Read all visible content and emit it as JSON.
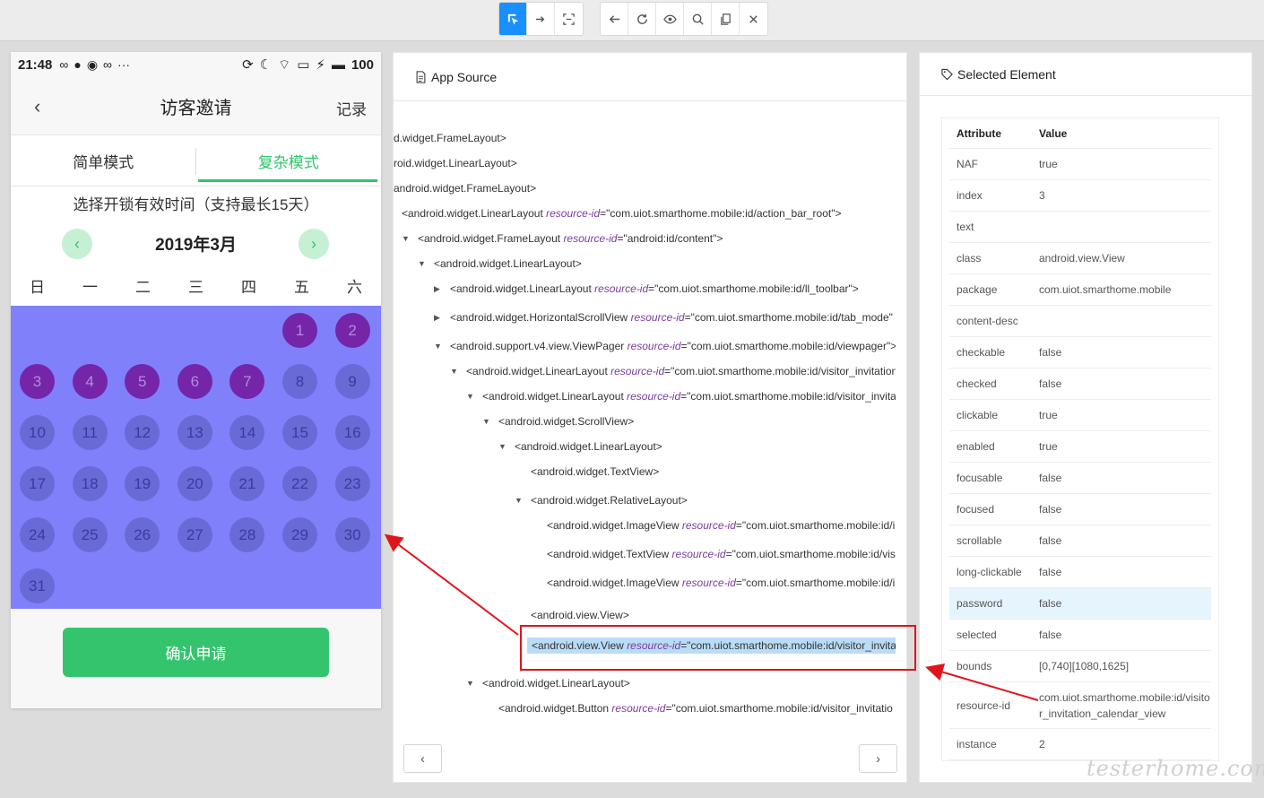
{
  "toolbar": {
    "icons": [
      "select-icon",
      "swipe-icon",
      "tap-coordinates-icon",
      "back-icon",
      "refresh-icon",
      "eye-icon",
      "search-icon",
      "copy-icon",
      "close-icon"
    ]
  },
  "phone": {
    "status": {
      "time": "21:48",
      "battery": "100"
    },
    "title": "访客邀请",
    "record": "记录",
    "tabs": [
      "简单模式",
      "复杂模式"
    ],
    "hint": "选择开锁有效时间（支持最长15天）",
    "month": "2019年3月",
    "weekdays": [
      "日",
      "一",
      "二",
      "三",
      "四",
      "五",
      "六"
    ],
    "days": [
      "1",
      "2",
      "3",
      "4",
      "5",
      "6",
      "7",
      "8",
      "9",
      "10",
      "11",
      "12",
      "13",
      "14",
      "15",
      "16",
      "17",
      "18",
      "19",
      "20",
      "21",
      "22",
      "23",
      "24",
      "25",
      "26",
      "27",
      "28",
      "29",
      "30",
      "31"
    ],
    "highlighted_days": [
      1,
      2,
      3,
      4,
      5,
      6,
      7
    ],
    "confirm": "确认申请",
    "colors": {
      "accent": "#35c46e",
      "calendar_bg": "#8080fb",
      "selected_day": "#7425a8"
    }
  },
  "source": {
    "title": "App Source",
    "nodes": [
      {
        "tag": "d.widget.FrameLayout>",
        "an": "",
        "av": ""
      },
      {
        "tag": "roid.widget.LinearLayout>",
        "an": "",
        "av": ""
      },
      {
        "tag": "android.widget.FrameLayout>",
        "an": "",
        "av": ""
      },
      {
        "tag": "<android.widget.LinearLayout ",
        "an": "resource-id",
        "av": "=\"com.uiot.smarthome.mobile:id/action_bar_root\">"
      },
      {
        "tag": "<android.widget.FrameLayout ",
        "an": "resource-id",
        "av": "=\"android:id/content\">"
      },
      {
        "tag": "<android.widget.LinearLayout>",
        "an": "",
        "av": ""
      },
      {
        "tag": "<android.widget.LinearLayout ",
        "an": "resource-id",
        "av": "=\"com.uiot.smarthome.mobile:id/ll_toolbar\">"
      },
      {
        "tag": "<android.widget.HorizontalScrollView ",
        "an": "resource-id",
        "av": "=\"com.uiot.smarthome.mobile:id/tab_mode\""
      },
      {
        "tag": "<android.support.v4.view.ViewPager ",
        "an": "resource-id",
        "av": "=\"com.uiot.smarthome.mobile:id/viewpager\">"
      },
      {
        "tag": "<android.widget.LinearLayout ",
        "an": "resource-id",
        "av": "=\"com.uiot.smarthome.mobile:id/visitor_invitation"
      },
      {
        "tag": "<android.widget.LinearLayout ",
        "an": "resource-id",
        "av": "=\"com.uiot.smarthome.mobile:id/visitor_invita"
      },
      {
        "tag": "<android.widget.ScrollView>",
        "an": "",
        "av": ""
      },
      {
        "tag": "<android.widget.LinearLayout>",
        "an": "",
        "av": ""
      },
      {
        "tag": "<android.widget.TextView>",
        "an": "",
        "av": ""
      },
      {
        "tag": "<android.widget.RelativeLayout>",
        "an": "",
        "av": ""
      },
      {
        "tag": "<android.widget.ImageView ",
        "an": "resource-id",
        "av": "=\"com.uiot.smarthome.mobile:id/i"
      },
      {
        "tag": "<android.widget.TextView ",
        "an": "resource-id",
        "av": "=\"com.uiot.smarthome.mobile:id/vis"
      },
      {
        "tag": "<android.widget.ImageView ",
        "an": "resource-id",
        "av": "=\"com.uiot.smarthome.mobile:id/i"
      },
      {
        "tag": "<android.view.View>",
        "an": "",
        "av": ""
      },
      {
        "tag": "<android.view.View ",
        "an": "resource-id",
        "av": "=\"com.uiot.smarthome.mobile:id/visitor_invita"
      },
      {
        "tag": "<android.widget.LinearLayout>",
        "an": "",
        "av": ""
      },
      {
        "tag": "<android.widget.Button ",
        "an": "resource-id",
        "av": "=\"com.uiot.smarthome.mobile:id/visitor_invitatio"
      }
    ]
  },
  "selected": {
    "title": "Selected Element",
    "header": {
      "attribute": "Attribute",
      "value": "Value"
    },
    "rows": [
      {
        "k": "NAF",
        "v": "true"
      },
      {
        "k": "index",
        "v": "3"
      },
      {
        "k": "text",
        "v": ""
      },
      {
        "k": "class",
        "v": "android.view.View"
      },
      {
        "k": "package",
        "v": "com.uiot.smarthome.mobile"
      },
      {
        "k": "content-desc",
        "v": ""
      },
      {
        "k": "checkable",
        "v": "false"
      },
      {
        "k": "checked",
        "v": "false"
      },
      {
        "k": "clickable",
        "v": "true"
      },
      {
        "k": "enabled",
        "v": "true"
      },
      {
        "k": "focusable",
        "v": "false"
      },
      {
        "k": "focused",
        "v": "false"
      },
      {
        "k": "scrollable",
        "v": "false"
      },
      {
        "k": "long-clickable",
        "v": "false"
      },
      {
        "k": "password",
        "v": "false"
      },
      {
        "k": "selected",
        "v": "false"
      },
      {
        "k": "bounds",
        "v": "[0,740][1080,1625]"
      },
      {
        "k": "resource-id",
        "v": "com.uiot.smarthome.mobile:id/visitor_invitation_calendar_view"
      },
      {
        "k": "instance",
        "v": "2"
      }
    ]
  },
  "watermark": "testerhome.com"
}
